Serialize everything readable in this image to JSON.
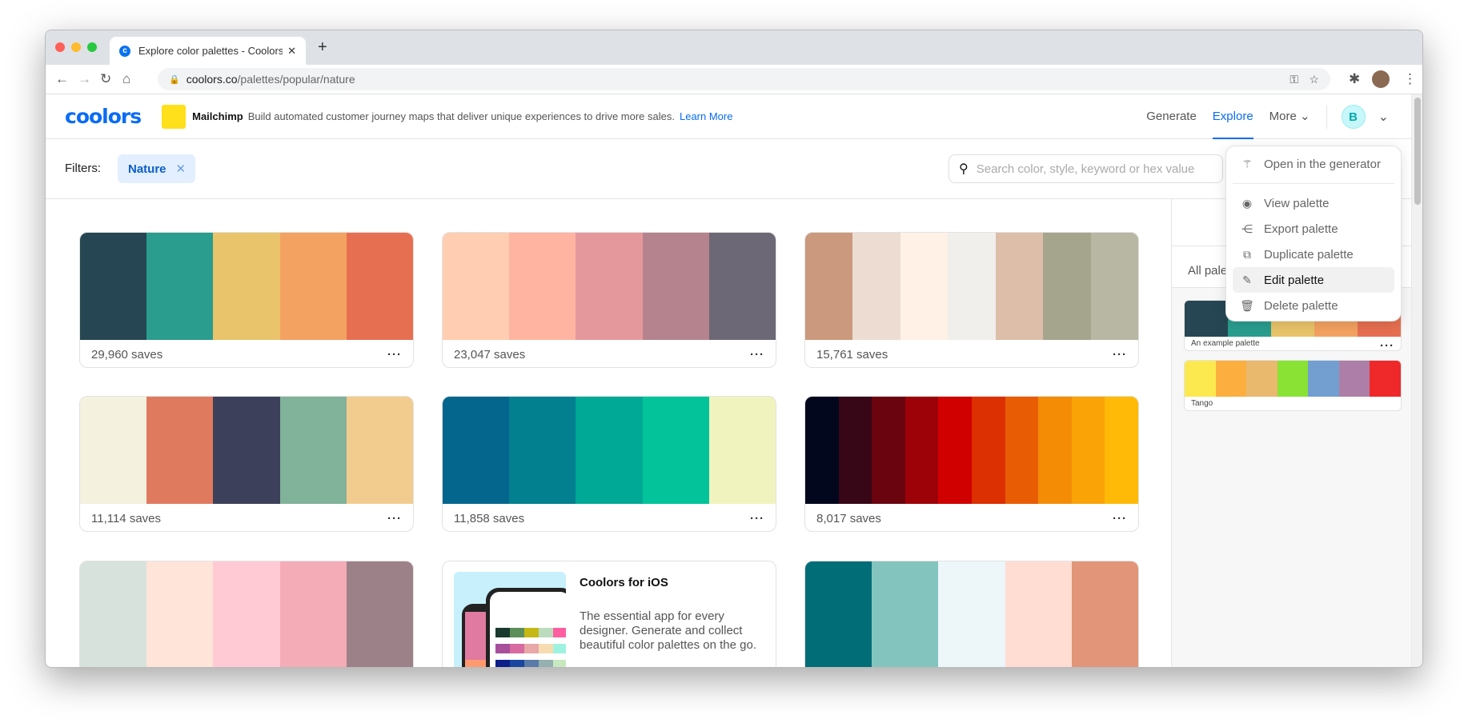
{
  "browser": {
    "tab_title": "Explore color palettes - Coolors",
    "url_host": "coolors.co",
    "url_path": "/palettes/popular/nature"
  },
  "header": {
    "logo": "coolors",
    "ad": {
      "brand": "Mailchimp",
      "text": "Build automated customer journey maps that deliver unique experiences to drive more sales.",
      "link": "Learn More"
    },
    "nav": {
      "generate": "Generate",
      "explore": "Explore",
      "more": "More"
    },
    "avatar": "B"
  },
  "filters": {
    "label": "Filters:",
    "chip": "Nature",
    "search_placeholder": "Search color, style, keyword or hex value"
  },
  "palettes": [
    {
      "colors": [
        "#264653",
        "#2a9d8f",
        "#e9c46a",
        "#f4a261",
        "#e76f51"
      ],
      "saves": "29,960 saves"
    },
    {
      "colors": [
        "#ffcdb2",
        "#ffb4a2",
        "#e5989b",
        "#b5838d",
        "#6d6875"
      ],
      "saves": "23,047 saves"
    },
    {
      "colors": [
        "#cb997e",
        "#eddcd2",
        "#fff1e6",
        "#f0efeb",
        "#ddbea9",
        "#a5a58d",
        "#b7b7a4"
      ],
      "saves": "15,761 saves"
    },
    {
      "colors": [
        "#f4f1de",
        "#e07a5f",
        "#3d405b",
        "#81b29a",
        "#f2cc8f"
      ],
      "saves": "11,114 saves"
    },
    {
      "colors": [
        "#05668d",
        "#028090",
        "#00a896",
        "#02c39a",
        "#f0f3bd"
      ],
      "saves": "11,858 saves"
    },
    {
      "colors": [
        "#03071e",
        "#370617",
        "#6a040f",
        "#9d0208",
        "#d00000",
        "#dc2f02",
        "#e85d04",
        "#f48c06",
        "#faa307",
        "#ffba08"
      ],
      "saves": "8,017 saves"
    },
    {
      "colors": [
        "#d8e2dc",
        "#ffe5d9",
        "#ffcad4",
        "#f4acb7",
        "#9d8189"
      ],
      "saves": ""
    },
    {
      "colors": [
        "#006d77",
        "#83c5be",
        "#edf6f9",
        "#ffddd2",
        "#e29578"
      ],
      "saves": ""
    }
  ],
  "promo": {
    "title": "Coolors for iOS",
    "text": "The essential app for every designer. Generate and collect beautiful color palettes on the go."
  },
  "sidebar": {
    "all_label": "All pale",
    "items": [
      {
        "name": "An example palette",
        "colors": [
          "#264653",
          "#2a9d8f",
          "#e9c46a",
          "#f4a261",
          "#e76f51"
        ]
      },
      {
        "name": "Tango",
        "colors": [
          "#fce94f",
          "#fcaf3e",
          "#e9b96e",
          "#8ae234",
          "#729fcf",
          "#ad7fa8",
          "#ef2929"
        ]
      }
    ]
  },
  "menu": {
    "items": [
      {
        "label": "Open in the generator",
        "icon": "magic-wand-icon"
      },
      {
        "label": "View palette",
        "icon": "eye-icon"
      },
      {
        "label": "Export palette",
        "icon": "share-icon"
      },
      {
        "label": "Duplicate palette",
        "icon": "duplicate-icon"
      },
      {
        "label": "Edit palette",
        "icon": "pencil-icon",
        "highlighted": true
      },
      {
        "label": "Delete palette",
        "icon": "trash-icon"
      }
    ]
  }
}
